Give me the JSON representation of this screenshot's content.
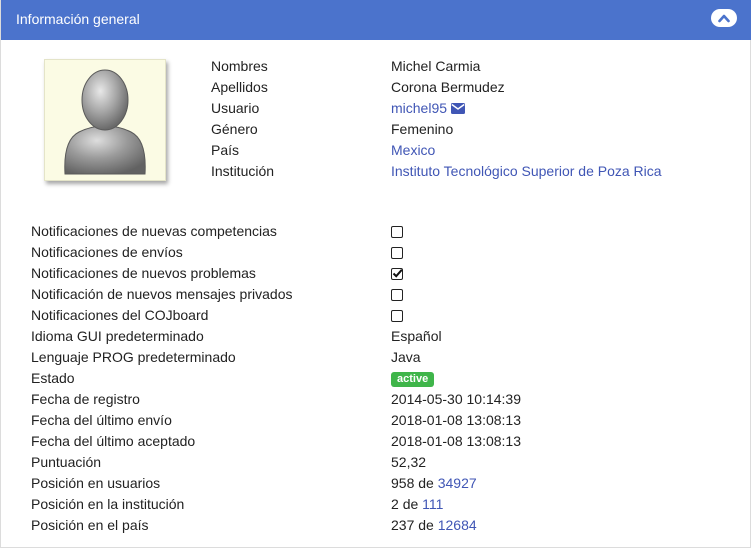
{
  "header": {
    "title": "Información general"
  },
  "profile": [
    {
      "label": "Nombres",
      "value": "Michel Carmia"
    },
    {
      "label": "Apellidos",
      "value": "Corona Bermudez"
    },
    {
      "label": "Usuario",
      "value": "michel95"
    },
    {
      "label": "Género",
      "value": "Femenino"
    },
    {
      "label": "País",
      "value": "Mexico"
    },
    {
      "label": "Institución",
      "value": "Instituto Tecnológico Superior de Poza Rica"
    }
  ],
  "notifications": [
    {
      "label": "Notificaciones de nuevas competencias",
      "checked": false
    },
    {
      "label": "Notificaciones de envíos",
      "checked": false
    },
    {
      "label": "Notificaciones de nuevos problemas",
      "checked": true
    },
    {
      "label": "Notificación de nuevos mensajes privados",
      "checked": false
    },
    {
      "label": "Notificaciones del COJboard",
      "checked": false
    }
  ],
  "details": {
    "idioma": {
      "label": "Idioma GUI predeterminado",
      "value": "Español"
    },
    "lenguaje": {
      "label": "Lenguaje PROG predeterminado",
      "value": "Java"
    },
    "estado": {
      "label": "Estado",
      "value": "active",
      "color": "#3fb54a"
    },
    "registro": {
      "label": "Fecha de registro",
      "value": "2014-05-30 10:14:39"
    },
    "ultimo_envio": {
      "label": "Fecha del último envío",
      "value": "2018-01-08 13:08:13"
    },
    "ultimo_aceptado": {
      "label": "Fecha del último aceptado",
      "value": "2018-01-08 13:08:13"
    },
    "puntuacion": {
      "label": "Puntuación",
      "value": "52,32"
    },
    "pos_usuarios": {
      "label": "Posición en usuarios",
      "rank": "958",
      "of": "de",
      "total": "34927"
    },
    "pos_institucion": {
      "label": "Posición en la institución",
      "rank": "2",
      "of": "de",
      "total": "111"
    },
    "pos_pais": {
      "label": "Posición en el país",
      "rank": "237",
      "of": "de",
      "total": "12684"
    }
  },
  "colors": {
    "header": "#4b73cc",
    "link": "#4056b5",
    "badge": "#3fb54a"
  }
}
